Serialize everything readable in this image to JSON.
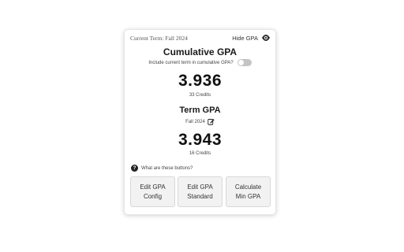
{
  "header": {
    "current_term": "Current Term: Fall 2024",
    "hide_label": "Hide GPA",
    "hide_icon": "eye-icon"
  },
  "cumulative": {
    "title": "Cumulative GPA",
    "include_label": "Include current term in cumulative GPA?",
    "include_toggle_on": false,
    "gpa": "3.936",
    "credits": "33 Credits"
  },
  "term": {
    "title": "Term GPA",
    "term_name": "Fall 2024",
    "edit_icon": "edit-icon",
    "gpa": "3.943",
    "credits": "16 Credits"
  },
  "help": {
    "icon": "question-circle-icon",
    "text": "What are these buttons?"
  },
  "buttons": [
    {
      "label": "Edit GPA\nConfig"
    },
    {
      "label": "Edit GPA\nStandard"
    },
    {
      "label": "Calculate\nMin GPA"
    }
  ],
  "colors": {
    "toggle_off": "#c4c4c4",
    "button_bg": "#f2f2f2"
  }
}
